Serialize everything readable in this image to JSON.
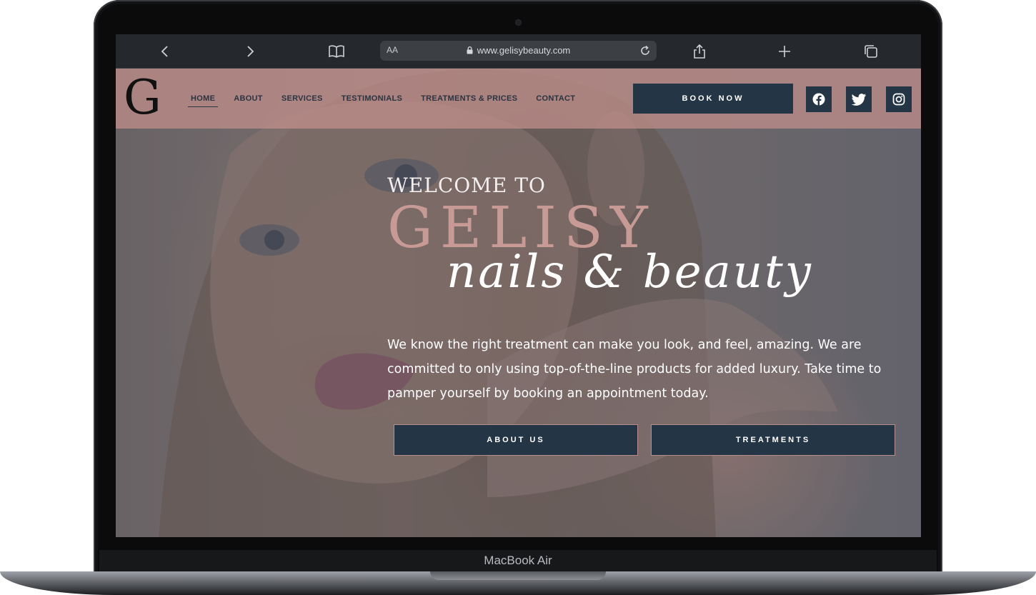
{
  "device": {
    "model_label": "MacBook Air"
  },
  "browser": {
    "url": "www.gelisybeauty.com",
    "text_size_label": "AA"
  },
  "site": {
    "logo": "G",
    "nav": [
      {
        "label": "HOME",
        "active": true
      },
      {
        "label": "ABOUT",
        "active": false
      },
      {
        "label": "SERVICES",
        "active": false
      },
      {
        "label": "TESTIMONIALS",
        "active": false
      },
      {
        "label": "TREATMENTS & PRICES",
        "active": false
      },
      {
        "label": "CONTACT",
        "active": false
      }
    ],
    "book_button": "BOOK NOW",
    "social": [
      "facebook-icon",
      "twitter-icon",
      "instagram-icon"
    ],
    "colors": {
      "accent": "#243646",
      "nav_bg": "#c4908c",
      "brand_pink": "#c79a95"
    }
  },
  "hero": {
    "welcome": "WELCOME TO",
    "brand": "GELISY",
    "tagline": "nails & beauty",
    "intro": "We know the right treatment can make you look, and feel, amazing. We are committed to only using top-of-the-line products for added luxury. Take time to pamper yourself by booking an appointment today.",
    "buttons": {
      "about": "ABOUT US",
      "treatments": "TREATMENTS"
    }
  }
}
